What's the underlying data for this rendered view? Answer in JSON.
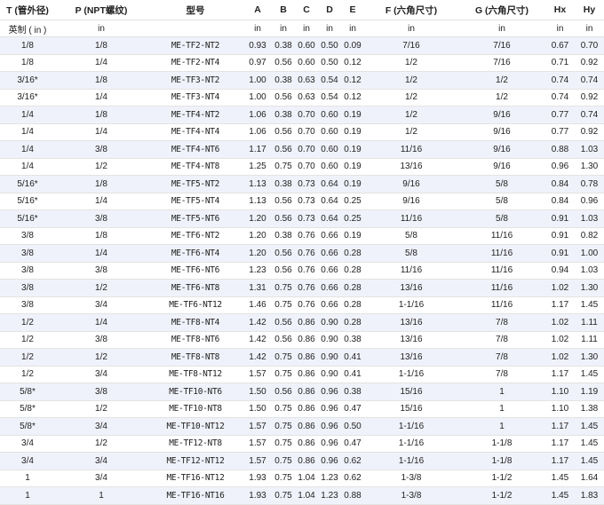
{
  "table": {
    "headers": [
      "T (管外径)",
      "P (NPT螺纹)",
      "型号",
      "A",
      "B",
      "C",
      "D",
      "E",
      "F (六角尺寸)",
      "G (六角尺寸)",
      "Hx",
      "Hy"
    ],
    "units": [
      "英制 ( in )",
      "in",
      "",
      "in",
      "in",
      "in",
      "in",
      "in",
      "in",
      "in",
      "in",
      "in"
    ],
    "rows": [
      [
        "1/8",
        "1/8",
        "ME-TF2-NT2",
        "0.93",
        "0.38",
        "0.60",
        "0.50",
        "0.09",
        "7/16",
        "7/16",
        "0.67",
        "0.70"
      ],
      [
        "1/8",
        "1/4",
        "ME-TF2-NT4",
        "0.97",
        "0.56",
        "0.60",
        "0.50",
        "0.12",
        "1/2",
        "7/16",
        "0.71",
        "0.92"
      ],
      [
        "3/16*",
        "1/8",
        "ME-TF3-NT2",
        "1.00",
        "0.38",
        "0.63",
        "0.54",
        "0.12",
        "1/2",
        "1/2",
        "0.74",
        "0.74"
      ],
      [
        "3/16*",
        "1/4",
        "ME-TF3-NT4",
        "1.00",
        "0.56",
        "0.63",
        "0.54",
        "0.12",
        "1/2",
        "1/2",
        "0.74",
        "0.92"
      ],
      [
        "1/4",
        "1/8",
        "ME-TF4-NT2",
        "1.06",
        "0.38",
        "0.70",
        "0.60",
        "0.19",
        "1/2",
        "9/16",
        "0.77",
        "0.74"
      ],
      [
        "1/4",
        "1/4",
        "ME-TF4-NT4",
        "1.06",
        "0.56",
        "0.70",
        "0.60",
        "0.19",
        "1/2",
        "9/16",
        "0.77",
        "0.92"
      ],
      [
        "1/4",
        "3/8",
        "ME-TF4-NT6",
        "1.17",
        "0.56",
        "0.70",
        "0.60",
        "0.19",
        "11/16",
        "9/16",
        "0.88",
        "1.03"
      ],
      [
        "1/4",
        "1/2",
        "ME-TF4-NT8",
        "1.25",
        "0.75",
        "0.70",
        "0.60",
        "0.19",
        "13/16",
        "9/16",
        "0.96",
        "1.30"
      ],
      [
        "5/16*",
        "1/8",
        "ME-TF5-NT2",
        "1.13",
        "0.38",
        "0.73",
        "0.64",
        "0.19",
        "9/16",
        "5/8",
        "0.84",
        "0.78"
      ],
      [
        "5/16*",
        "1/4",
        "ME-TF5-NT4",
        "1.13",
        "0.56",
        "0.73",
        "0.64",
        "0.25",
        "9/16",
        "5/8",
        "0.84",
        "0.96"
      ],
      [
        "5/16*",
        "3/8",
        "ME-TF5-NT6",
        "1.20",
        "0.56",
        "0.73",
        "0.64",
        "0.25",
        "11/16",
        "5/8",
        "0.91",
        "1.03"
      ],
      [
        "3/8",
        "1/8",
        "ME-TF6-NT2",
        "1.20",
        "0.38",
        "0.76",
        "0.66",
        "0.19",
        "5/8",
        "11/16",
        "0.91",
        "0.82"
      ],
      [
        "3/8",
        "1/4",
        "ME-TF6-NT4",
        "1.20",
        "0.56",
        "0.76",
        "0.66",
        "0.28",
        "5/8",
        "11/16",
        "0.91",
        "1.00"
      ],
      [
        "3/8",
        "3/8",
        "ME-TF6-NT6",
        "1.23",
        "0.56",
        "0.76",
        "0.66",
        "0.28",
        "11/16",
        "11/16",
        "0.94",
        "1.03"
      ],
      [
        "3/8",
        "1/2",
        "ME-TF6-NT8",
        "1.31",
        "0.75",
        "0.76",
        "0.66",
        "0.28",
        "13/16",
        "11/16",
        "1.02",
        "1.30"
      ],
      [
        "3/8",
        "3/4",
        "ME-TF6-NT12",
        "1.46",
        "0.75",
        "0.76",
        "0.66",
        "0.28",
        "1-1/16",
        "11/16",
        "1.17",
        "1.45"
      ],
      [
        "1/2",
        "1/4",
        "ME-TF8-NT4",
        "1.42",
        "0.56",
        "0.86",
        "0.90",
        "0.28",
        "13/16",
        "7/8",
        "1.02",
        "1.11"
      ],
      [
        "1/2",
        "3/8",
        "ME-TF8-NT6",
        "1.42",
        "0.56",
        "0.86",
        "0.90",
        "0.38",
        "13/16",
        "7/8",
        "1.02",
        "1.11"
      ],
      [
        "1/2",
        "1/2",
        "ME-TF8-NT8",
        "1.42",
        "0.75",
        "0.86",
        "0.90",
        "0.41",
        "13/16",
        "7/8",
        "1.02",
        "1.30"
      ],
      [
        "1/2",
        "3/4",
        "ME-TF8-NT12",
        "1.57",
        "0.75",
        "0.86",
        "0.90",
        "0.41",
        "1-1/16",
        "7/8",
        "1.17",
        "1.45"
      ],
      [
        "5/8*",
        "3/8",
        "ME-TF10-NT6",
        "1.50",
        "0.56",
        "0.86",
        "0.96",
        "0.38",
        "15/16",
        "1",
        "1.10",
        "1.19"
      ],
      [
        "5/8*",
        "1/2",
        "ME-TF10-NT8",
        "1.50",
        "0.75",
        "0.86",
        "0.96",
        "0.47",
        "15/16",
        "1",
        "1.10",
        "1.38"
      ],
      [
        "5/8*",
        "3/4",
        "ME-TF10-NT12",
        "1.57",
        "0.75",
        "0.86",
        "0.96",
        "0.50",
        "1-1/16",
        "1",
        "1.17",
        "1.45"
      ],
      [
        "3/4",
        "1/2",
        "ME-TF12-NT8",
        "1.57",
        "0.75",
        "0.86",
        "0.96",
        "0.47",
        "1-1/16",
        "1-1/8",
        "1.17",
        "1.45"
      ],
      [
        "3/4",
        "3/4",
        "ME-TF12-NT12",
        "1.57",
        "0.75",
        "0.86",
        "0.96",
        "0.62",
        "1-1/16",
        "1-1/8",
        "1.17",
        "1.45"
      ],
      [
        "1",
        "3/4",
        "ME-TF16-NT12",
        "1.93",
        "0.75",
        "1.04",
        "1.23",
        "0.62",
        "1-3/8",
        "1-1/2",
        "1.45",
        "1.64"
      ],
      [
        "1",
        "1",
        "ME-TF16-NT16",
        "1.93",
        "0.75",
        "1.04",
        "1.23",
        "0.88",
        "1-3/8",
        "1-1/2",
        "1.45",
        "1.83"
      ]
    ]
  }
}
